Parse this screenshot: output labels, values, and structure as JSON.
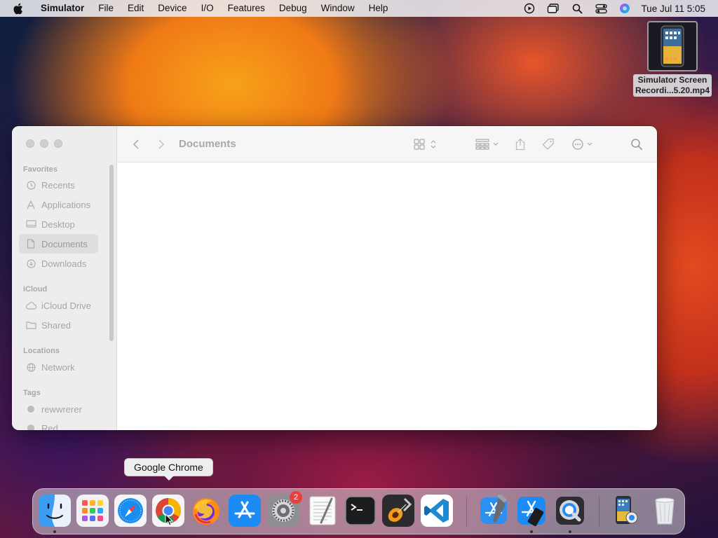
{
  "menubar": {
    "apple_icon": "apple-logo",
    "app_name": "Simulator",
    "items": [
      "File",
      "Edit",
      "Device",
      "I/O",
      "Features",
      "Debug",
      "Window",
      "Help"
    ],
    "status_icons": [
      "play-circle-icon",
      "screen-mirroring-icon",
      "search-icon",
      "control-center-icon",
      "siri-icon"
    ],
    "clock": "Tue Jul 11  5:05"
  },
  "desktop": {
    "file_label_line1": "Simulator Screen",
    "file_label_line2": "Recordi...5.20.mp4"
  },
  "finder": {
    "title": "Documents",
    "sidebar": {
      "favorites_header": "Favorites",
      "favorites": [
        {
          "label": "Recents",
          "icon": "clock-icon"
        },
        {
          "label": "Applications",
          "icon": "applications-icon"
        },
        {
          "label": "Desktop",
          "icon": "desktop-icon"
        },
        {
          "label": "Documents",
          "icon": "document-icon",
          "selected": true
        },
        {
          "label": "Downloads",
          "icon": "download-icon"
        }
      ],
      "icloud_header": "iCloud",
      "icloud": [
        {
          "label": "iCloud Drive",
          "icon": "cloud-icon"
        },
        {
          "label": "Shared",
          "icon": "shared-folder-icon"
        }
      ],
      "locations_header": "Locations",
      "locations": [
        {
          "label": "Network",
          "icon": "globe-icon"
        }
      ],
      "tags_header": "Tags",
      "tags": [
        {
          "label": "rewwrerer",
          "color": "#bdbdbd"
        },
        {
          "label": "Red",
          "color": "#bdbdbd"
        }
      ]
    }
  },
  "dock": {
    "tooltip": "Google Chrome",
    "apps": [
      "Finder",
      "Launchpad",
      "Safari",
      "Google Chrome",
      "Firefox",
      "App Store",
      "System Settings",
      "TextEdit",
      "Terminal",
      "GarageBand",
      "Visual Studio Code",
      "Xcode",
      "Simulator",
      "QuickTime Player"
    ],
    "settings_badge": "2",
    "recents": [
      "Simulator Screen Recording",
      "Trash"
    ]
  },
  "colors": {
    "selected_sidebar": "#dedede",
    "badge": "#e8413c"
  }
}
